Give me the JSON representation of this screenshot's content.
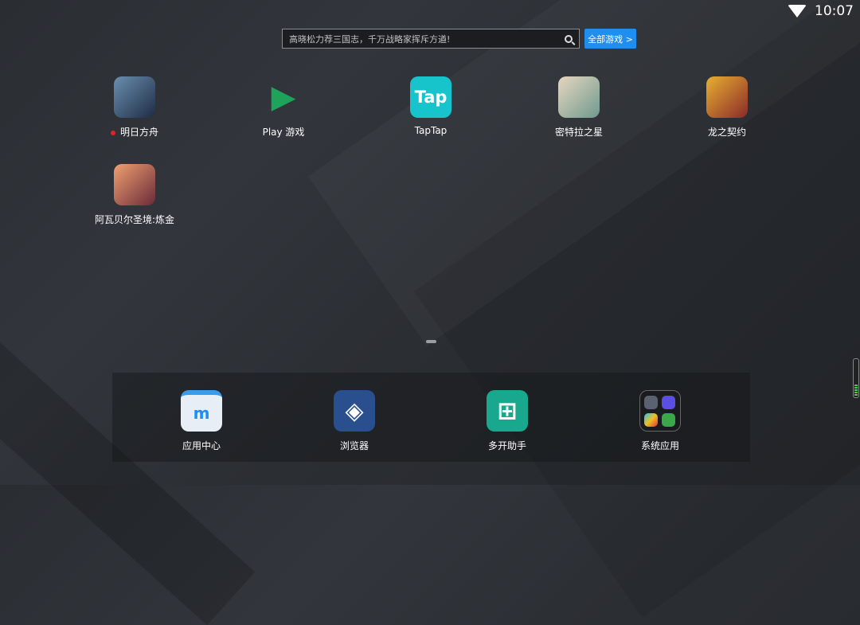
{
  "status": {
    "time": "10:07"
  },
  "search": {
    "placeholder": "高晓松力荐三国志，千万战略家挥斥方遒!",
    "all_games": "全部游戏 >"
  },
  "apps": [
    {
      "label": "明日方舟",
      "color": "#2a4a6a",
      "glyph": "",
      "new_dot": true
    },
    {
      "label": "Play 游戏",
      "color": "#1e9e55",
      "glyph": "▶"
    },
    {
      "label": "TapTap",
      "color": "#18c4cc",
      "glyph": "Tap"
    },
    {
      "label": "密特拉之星",
      "color": "#8fa7a0",
      "glyph": ""
    },
    {
      "label": "龙之契约",
      "color": "#b5442a",
      "glyph": ""
    },
    {
      "label": "阿瓦贝尔圣境:炼金",
      "color": "#c45a3a",
      "glyph": ""
    }
  ],
  "dock": [
    {
      "label": "应用中心",
      "color": "#e8eef5",
      "glyph": "m"
    },
    {
      "label": "浏览器",
      "color": "#2a4f8f",
      "glyph": "◈"
    },
    {
      "label": "多开助手",
      "color": "#18a88e",
      "glyph": "⊞"
    },
    {
      "label": "系统应用",
      "color": "#1a1b1e",
      "glyph": ""
    }
  ]
}
